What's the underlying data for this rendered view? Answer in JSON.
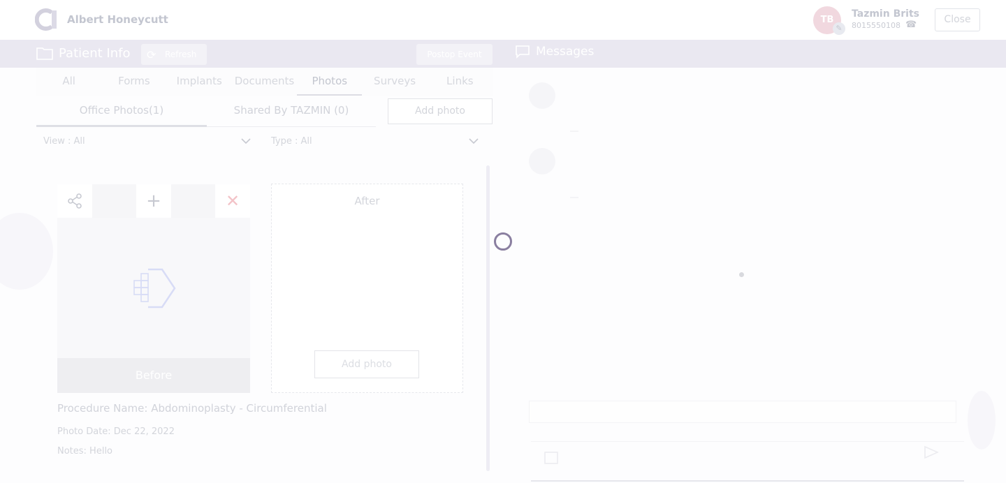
{
  "header": {
    "practice_name": "Albert Honeycutt",
    "user_initials": "TB",
    "user_name": "Tazmin Brits",
    "user_phone": "8015550108",
    "close_label": "Close"
  },
  "section_bar": {
    "title": "Patient Info",
    "refresh_label": "Refresh",
    "postop_label": "Postop Event",
    "messages_title": "Messages"
  },
  "tabs": [
    "All",
    "Forms",
    "Implants",
    "Documents",
    "Photos",
    "Surveys",
    "Links"
  ],
  "active_tab": "Photos",
  "subtabs": {
    "office": "Office Photos(1)",
    "shared": "Shared By TAZMIN (0)",
    "add_photo": "Add photo"
  },
  "filters": {
    "view": "View : All",
    "type": "Type : All"
  },
  "photo_card": {
    "before_label": "Before",
    "after_label": "After",
    "add_photo_label": "Add photo",
    "procedure": "Procedure Name: Abdominoplasty - Circumferential",
    "photo_date": "Photo Date: Dec 22, 2022",
    "notes": "Notes: Hello"
  },
  "icons": {
    "logo": "brand-logo",
    "folder": "folder-icon",
    "refresh": "refresh-icon",
    "messages": "chat-bubble-icon",
    "share": "share-icon",
    "add": "plus-icon",
    "close": "close-icon",
    "placeholder": "image-placeholder-icon",
    "phone": "phone-icon",
    "edit": "pencil-icon"
  },
  "colors": {
    "section_bar": "#eae8f1",
    "spinner": "#8a7fa0",
    "close_icon": "#f3c3c8"
  }
}
